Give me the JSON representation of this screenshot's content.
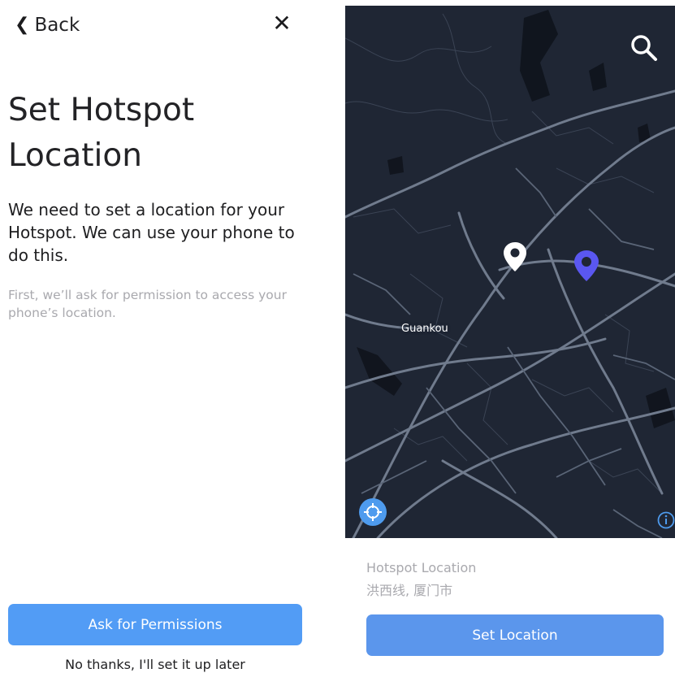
{
  "onboarding": {
    "back_label": "Back",
    "back_icon": "chevron-left",
    "close_icon": "close-x",
    "title": "Set Hotspot Location",
    "intro": "We need to set a location for your Hotspot. We can use your phone to do this.",
    "hint": "First, we’ll ask for permission to access your phone’s location.",
    "primary_button": "Ask for Permissions",
    "skip_link": "No thanks, I'll set it up later"
  },
  "map_screen": {
    "place_label": "Guankou",
    "search_icon": "search",
    "locate_icon": "crosshair",
    "info_icon": "info",
    "location_caption": "Hotspot Location",
    "location_value": "洪西线, 厦门市",
    "set_button": "Set Location"
  },
  "colors": {
    "accent": "#529cf5",
    "set_button": "#5b96ec",
    "map_background": "#1f2634",
    "map_roads": "#7a8596",
    "hotspot_pin": "#5a57f0",
    "muted_text": "#a9a9ae"
  }
}
